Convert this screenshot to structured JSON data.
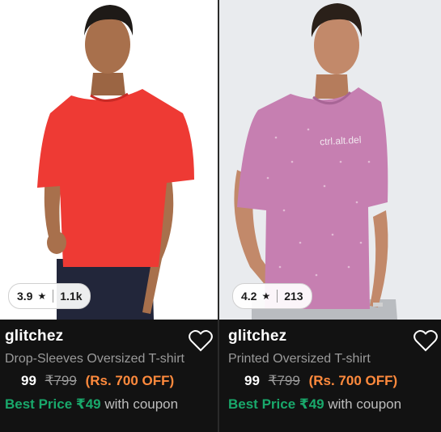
{
  "products": [
    {
      "brand": "glitchez",
      "title": "Drop-Sleeves Oversized T-shirt",
      "rating": "3.9",
      "reviews": "1.1k",
      "price": "99",
      "mrp": "₹799",
      "discount": "(Rs. 700 OFF)",
      "best_price": "Best Price ₹49",
      "coupon_text": "with coupon",
      "shirt_color": "#ee3a34",
      "image_bg": "#ffffff"
    },
    {
      "brand": "glitchez",
      "title": "Printed Oversized T-shirt",
      "rating": "4.2",
      "reviews": "213",
      "price": "99",
      "mrp": "₹799",
      "discount": "(Rs. 700 OFF)",
      "best_price": "Best Price ₹49",
      "coupon_text": "with coupon",
      "shirt_color": "#c67fb1",
      "shirt_print": "ctrl.alt.del",
      "image_bg": "#e9ebee"
    }
  ],
  "icons": {
    "wishlist": "heart-outline-icon",
    "rating": "star-icon"
  },
  "colors": {
    "discount": "#ff8a3d",
    "best_price": "#19a86b",
    "background": "#121212"
  }
}
